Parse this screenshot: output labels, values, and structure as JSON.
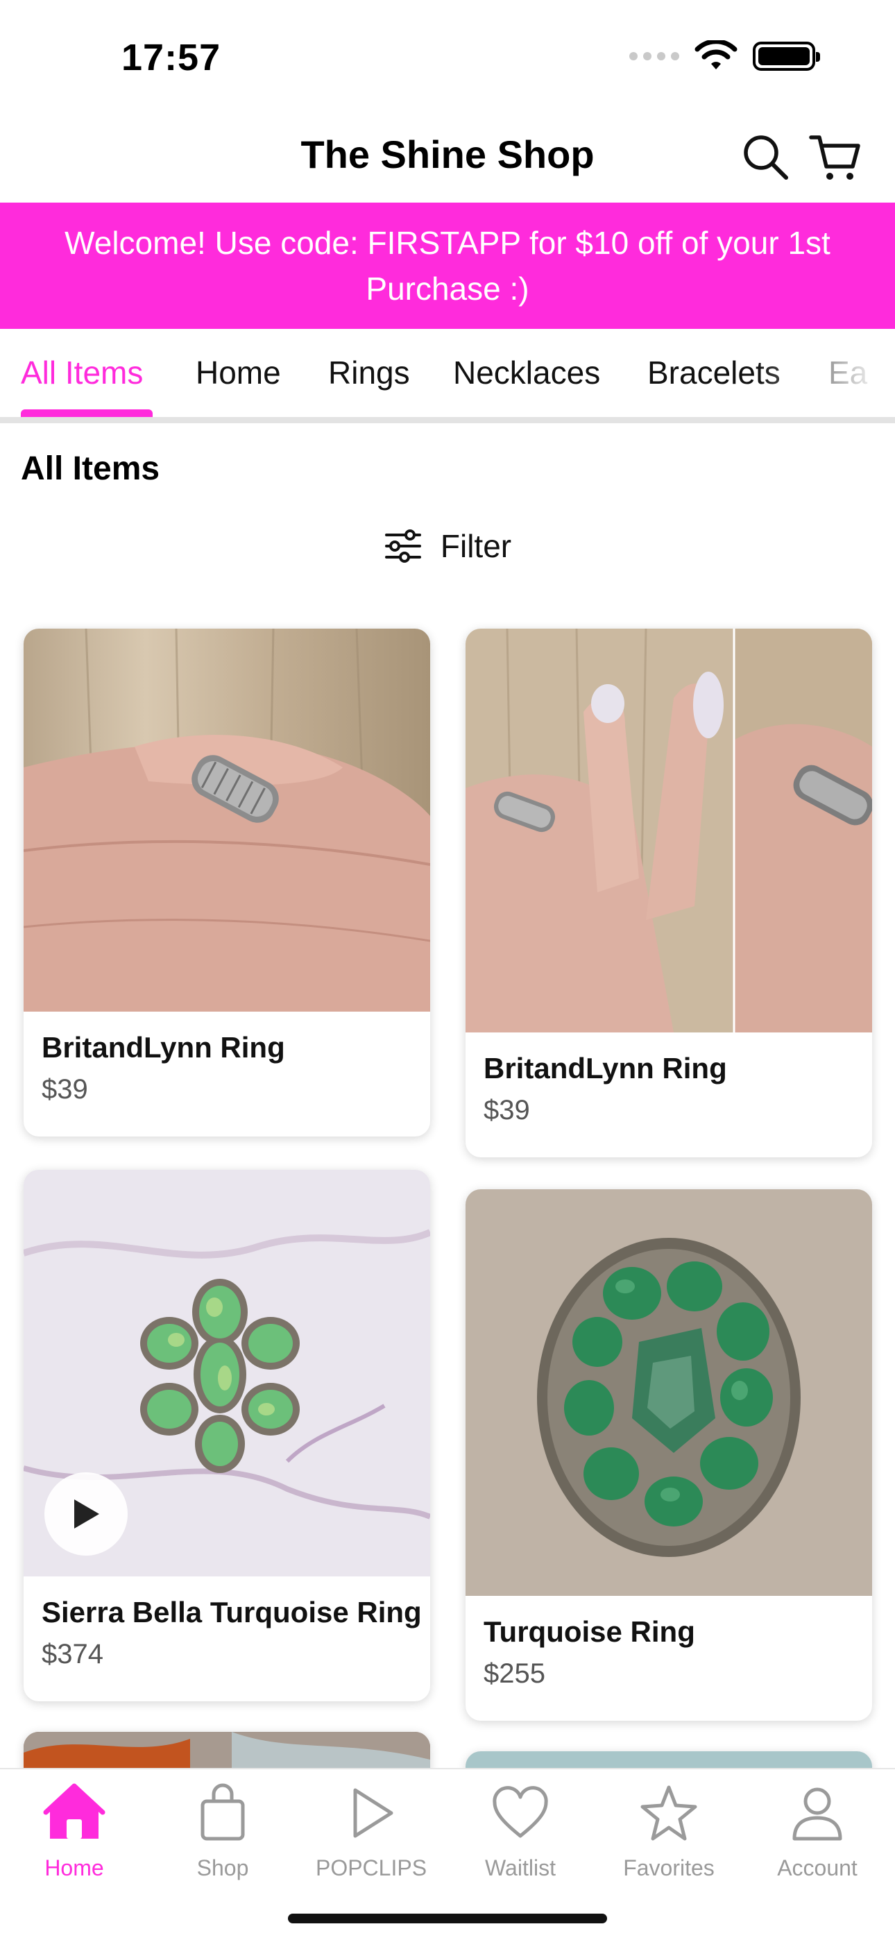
{
  "status_bar": {
    "time": "17:57"
  },
  "header": {
    "title": "The Shine Shop"
  },
  "promo": {
    "text": "Welcome! Use code: FIRSTAPP for $10 off of your 1st Purchase :)"
  },
  "tabs": [
    {
      "label": "All Items"
    },
    {
      "label": "Home"
    },
    {
      "label": "Rings"
    },
    {
      "label": "Necklaces"
    },
    {
      "label": "Bracelets"
    },
    {
      "label": "Ea"
    }
  ],
  "section": {
    "title": "All Items",
    "filter_label": "Filter"
  },
  "products": [
    {
      "name": "BritandLynn Ring",
      "price": "$39"
    },
    {
      "name": "BritandLynn Ring",
      "price": "$39"
    },
    {
      "name": "Sierra Bella Turquoise Ring",
      "price": "$374"
    },
    {
      "name": "Turquoise Ring",
      "price": "$255"
    }
  ],
  "nav": [
    {
      "label": "Home",
      "icon": "home-icon"
    },
    {
      "label": "Shop",
      "icon": "shopping-bag-icon"
    },
    {
      "label": "POPCLIPS",
      "icon": "play-icon"
    },
    {
      "label": "Waitlist",
      "icon": "heart-icon"
    },
    {
      "label": "Favorites",
      "icon": "star-icon"
    },
    {
      "label": "Account",
      "icon": "person-icon"
    }
  ],
  "colors": {
    "accent": "#ff2bdc",
    "inactive": "#9a9a9a",
    "text": "#111111"
  }
}
